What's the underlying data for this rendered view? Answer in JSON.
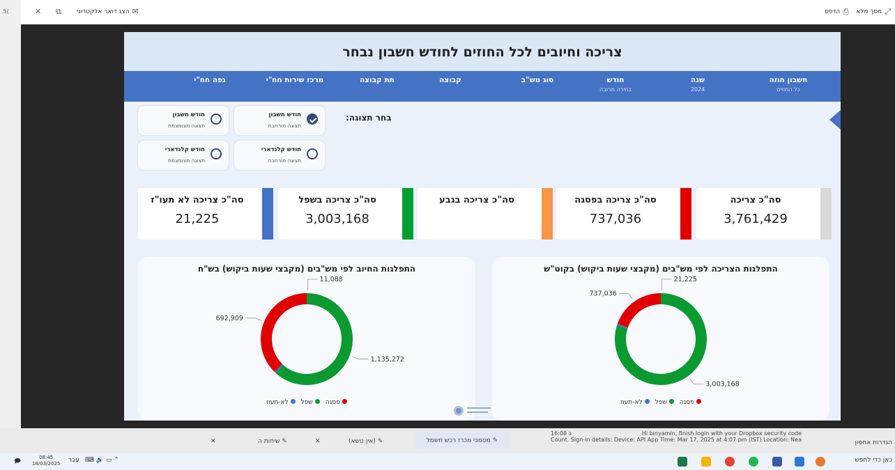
{
  "viewer": {
    "fullscreen_label": "מסך מלא",
    "print_label": "הדפס",
    "email_label": "הצג דואר אלקטרוני",
    "left_number": ".5("
  },
  "report": {
    "title": "צריכה וחיובים לכל החוזים לחודש חשבון נבחר",
    "filters": [
      {
        "label": "חשבון חוזה",
        "sub": "כל החוזים"
      },
      {
        "label": "שנה",
        "sub": "2024"
      },
      {
        "label": "חודש",
        "sub": "בחירה מרובה"
      },
      {
        "label": "סוג מש\"ב",
        "sub": ""
      },
      {
        "label": "קבוצה",
        "sub": ""
      },
      {
        "label": "תת קבוצה",
        "sub": ""
      },
      {
        "label": "מרכז שירות חח\"י",
        "sub": ""
      },
      {
        "label": "נפה חח\"י",
        "sub": ""
      }
    ],
    "display_label": "בחר תצוגה:",
    "options": [
      {
        "title": "חודש חשבון",
        "sub": "תצוגה מורחבת",
        "checked": true
      },
      {
        "title": "חודש חשבון",
        "sub": "תצוגה מצומצמת",
        "checked": false
      },
      {
        "title": "חודש קלנדארי",
        "sub": "תצוגה מורחבת",
        "checked": false
      },
      {
        "title": "חודש קלנדארי",
        "sub": "תצוגה מצומצמת",
        "checked": false
      }
    ],
    "kpis": [
      {
        "title": "סה\"כ צריכה",
        "value": "3,761,429",
        "color": "#d9d9d9"
      },
      {
        "title": "סה\"כ צריכה בפסגה",
        "value": "737,036",
        "color": "#e00000"
      },
      {
        "title": "סה\"כ צריכה בגבע",
        "value": "",
        "color": "#f79646"
      },
      {
        "title": "סה\"כ צריכה בשפל",
        "value": "3,003,168",
        "color": "#00a030"
      },
      {
        "title": "סה\"כ צריכה לא תעו\"ז",
        "value": "21,225",
        "color": "#4472c4"
      }
    ],
    "legend": {
      "peak": "פסגה",
      "low": "שפל",
      "na": "לא-תעוז"
    },
    "colors": {
      "peak": "#e00000",
      "low": "#0a9a30",
      "na": "#4472c4"
    }
  },
  "chart_data": [
    {
      "type": "pie",
      "title": "התפלגות הצריכה לפי מש\"בים (מקבצי שעות ביקוש) בקוט\"ש",
      "categories": [
        "פסגה",
        "שפל",
        "לא-תעוז"
      ],
      "values": [
        737036,
        3003168,
        21225
      ],
      "labels": [
        "737,036",
        "3,003,168",
        "21,225"
      ],
      "legend_position": "bottom"
    },
    {
      "type": "pie",
      "title": "התפלגות החיוב לפי מש\"בים (מקבצי שעות ביקוש) בש\"ח",
      "categories": [
        "פסגה",
        "שפל",
        "לא-תעוז"
      ],
      "values": [
        692909,
        1135272,
        11088
      ],
      "labels": [
        "692,909",
        "1,135,272",
        "11,088"
      ],
      "legend_position": "bottom"
    }
  ],
  "below_tabs": {
    "tab1": "מסמכי מכרז רכש חשמל",
    "tab2": "(אין נושא)",
    "tab3": "שיחות ה",
    "email_from": "Hi binyamin, finish login with your Dropbox security code",
    "email_detail": "Count. Sign-in details: Device: API App Time: Mar 17, 2025 at 4:07 pm (IST) Location: Near Se",
    "email_time": "16:08 ב",
    "right_label": "הגדרות אחסון"
  },
  "taskbar": {
    "time": "08:45",
    "date": "18/03/2025",
    "lang": "עבר",
    "search": "כאן כדי לחפש"
  }
}
